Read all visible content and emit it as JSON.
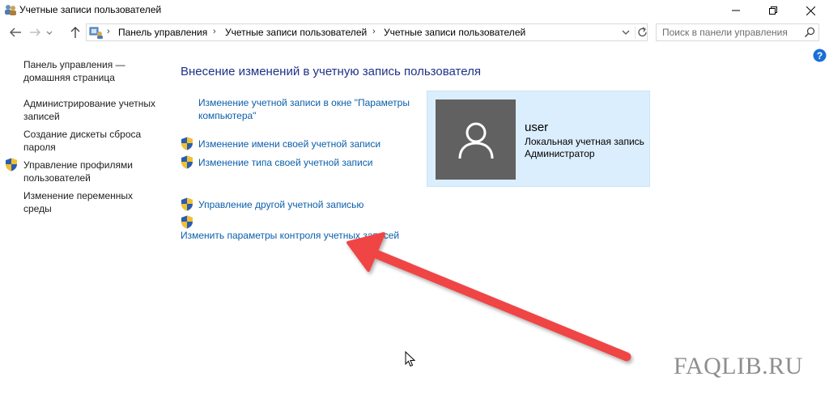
{
  "window": {
    "title": "Учетные записи пользователей",
    "icons": {
      "app": "users-icon",
      "minimize": "minimize-icon",
      "maximize": "restore-icon",
      "close": "close-icon"
    }
  },
  "address_bar": {
    "breadcrumbs": [
      "Панель управления",
      "Учетные записи пользователей",
      "Учетные записи пользователей"
    ],
    "search_placeholder": "Поиск в панели управления",
    "icons": {
      "back": "arrow-left-icon",
      "forward": "arrow-right-icon",
      "up": "arrow-up-icon",
      "refresh": "refresh-icon",
      "search": "search-icon"
    }
  },
  "sidebar": {
    "links": [
      {
        "label": "Панель управления —",
        "label2": "домашняя страница",
        "shield": false
      },
      {
        "label": "Администрирование учетных",
        "label2": "записей",
        "shield": false
      },
      {
        "label": "Создание дискеты сброса",
        "label2": "пароля",
        "shield": false
      },
      {
        "label": "Управление профилями",
        "label2": "пользователей",
        "shield": true
      },
      {
        "label": "Изменение переменных",
        "label2": "среды",
        "shield": false
      }
    ]
  },
  "main": {
    "heading": "Внесение изменений в учетную запись пользователя",
    "links": [
      {
        "label": "Изменение учетной записи в окне \"Параметры",
        "label2": "компьютера\"",
        "shield": false
      },
      {
        "label": "Изменение имени своей учетной записи",
        "shield": true
      },
      {
        "label": "Изменение типа своей учетной записи",
        "shield": true
      },
      {
        "label": "Управление другой учетной записью",
        "shield": true
      },
      {
        "label": "Изменить параметры контроля учетных записей",
        "shield": true
      }
    ]
  },
  "user_card": {
    "name": "user",
    "account_type": "Локальная учетная запись",
    "role": "Администратор",
    "icons": {
      "avatar": "user-silhouette-icon"
    }
  },
  "overlay": {
    "watermark": "FAQLIB.RU",
    "arrow_color": "#f04444"
  },
  "colors": {
    "link": "#0b5fab",
    "heading": "#1e3287",
    "card_bg": "#dbeefd",
    "avatar_bg": "#616161"
  }
}
